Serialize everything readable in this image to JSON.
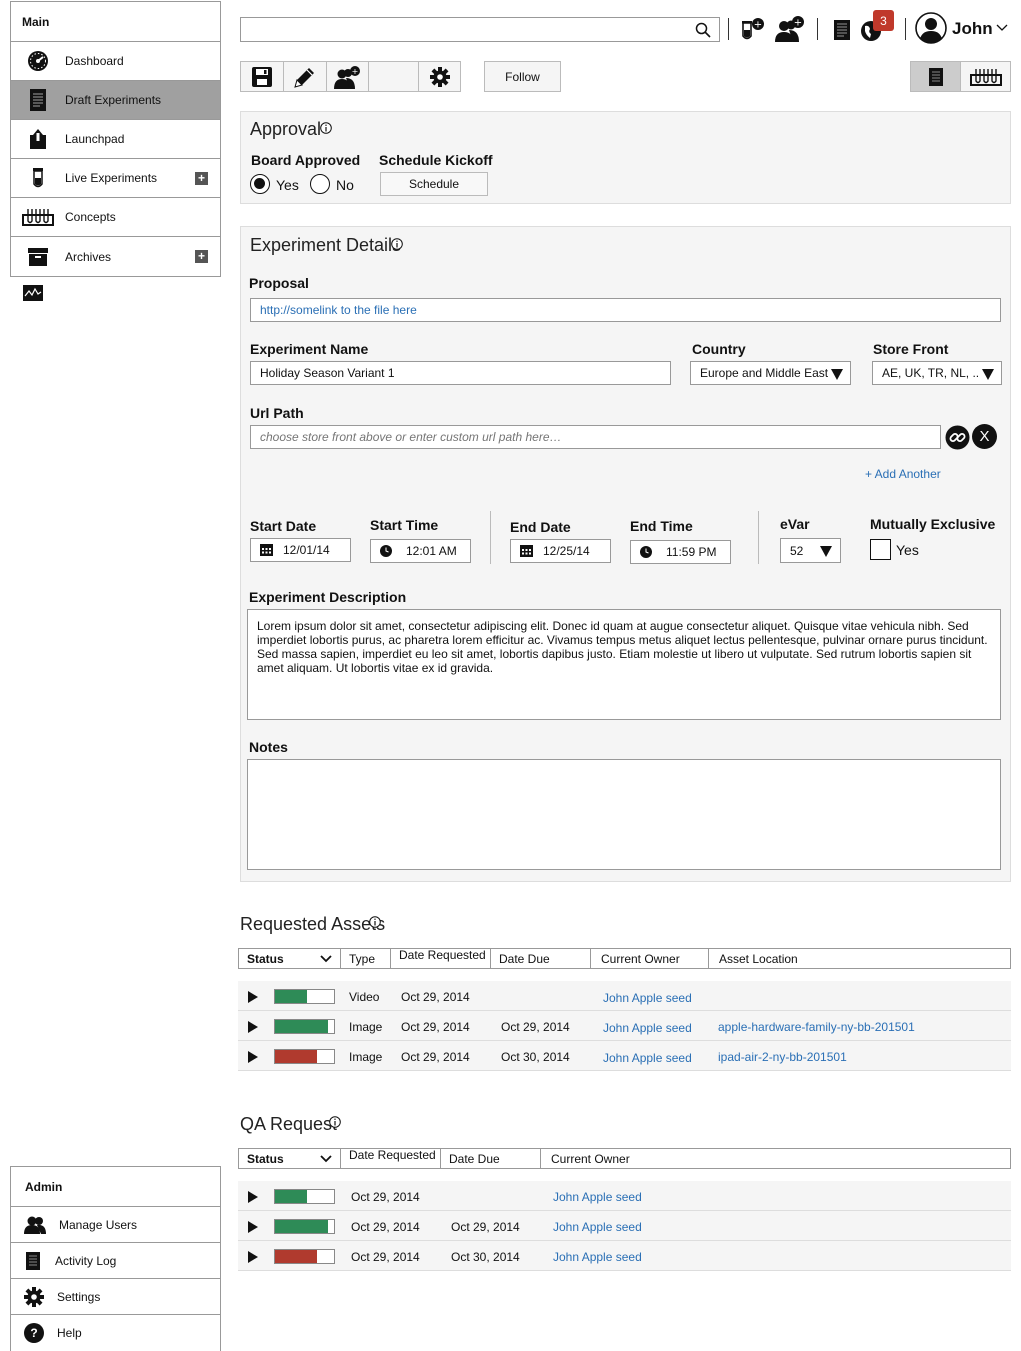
{
  "sidebar": {
    "main_header": "Main",
    "items": [
      {
        "label": "Dashboard",
        "icon": "speedometer-icon"
      },
      {
        "label": "Draft Experiments",
        "icon": "document-icon"
      },
      {
        "label": "Launchpad",
        "icon": "upload-icon"
      },
      {
        "label": "Live Experiments",
        "icon": "test-tube-icon",
        "plus": "+"
      },
      {
        "label": "Concepts",
        "icon": "test-tubes-rack-icon"
      },
      {
        "label": "Archives",
        "icon": "archive-box-icon",
        "plus": "+"
      }
    ],
    "admin_header": "Admin",
    "admin_items": [
      {
        "label": "Manage Users",
        "icon": "users-icon"
      },
      {
        "label": "Activity Log",
        "icon": "log-icon"
      },
      {
        "label": "Settings",
        "icon": "gear-icon"
      },
      {
        "label": "Help",
        "icon": "help-icon",
        "glyph": "?"
      }
    ]
  },
  "topbar": {
    "search_value": "",
    "notification_count": "3",
    "user_name": "John"
  },
  "toolbar": {
    "follow_label": "Follow"
  },
  "approval": {
    "title": "Approval",
    "board_label": "Board Approved",
    "yes": "Yes",
    "no": "No",
    "selected": "Yes",
    "schedule_label": "Schedule Kickoff",
    "schedule_button": "Schedule"
  },
  "details": {
    "title": "Experiment Details",
    "proposal_label": "Proposal",
    "proposal_value": "http://somelink to the file here",
    "name_label": "Experiment Name",
    "name_value": "Holiday Season Variant 1",
    "country_label": "Country",
    "country_value": "Europe and Middle East",
    "store_label": "Store Front",
    "store_value": "AE, UK, TR, NL, ...",
    "url_label": "Url Path",
    "url_placeholder": "choose store front above or enter custom url path here…",
    "clear_glyph": "X",
    "add_another": "+ Add Another",
    "start_date_label": "Start Date",
    "start_date": "12/01/14",
    "start_time_label": "Start Time",
    "start_time": "12:01 AM",
    "end_date_label": "End Date",
    "end_date": "12/25/14",
    "end_time_label": "End Time",
    "end_time": "11:59 PM",
    "evar_label": "eVar",
    "evar_value": "52",
    "mutex_label": "Mutually Exclusive",
    "mutex_option": "Yes",
    "desc_label": "Experiment Description",
    "desc_value": "Lorem ipsum dolor sit amet, consectetur adipiscing elit. Donec id quam at augue consectetur aliquet. Quisque vitae vehicula nibh. Sed imperdiet lobortis purus, ac pharetra lorem efficitur ac. Vivamus tempus metus aliquet lectus pellentesque, pulvinar ornare purus tincidunt. Sed massa sapien, imperdiet eu leo sit amet, lobortis dapibus justo. Etiam molestie ut libero ut vulputate. Sed rutrum lobortis sapien sit amet aliquam. Ut lobortis vitae ex id gravida.",
    "notes_label": "Notes",
    "notes_value": ""
  },
  "assets": {
    "title": "Requested Assets",
    "columns": [
      "Status",
      "Type",
      "Date Requested",
      "Date Due",
      "Current Owner",
      "Asset Location"
    ],
    "rows": [
      {
        "progress": 0.55,
        "color": "#2e8b57",
        "type": "Video",
        "requested": "Oct 29, 2014",
        "due": "",
        "owner": "John Apple seed",
        "location": ""
      },
      {
        "progress": 0.9,
        "color": "#2e8b57",
        "type": "Image",
        "requested": "Oct 29, 2014",
        "due": "Oct 29, 2014",
        "owner": "John Apple seed",
        "location": "apple-hardware-family-ny-bb-201501"
      },
      {
        "progress": 0.72,
        "color": "#b03a2e",
        "type": "Image",
        "requested": "Oct 29, 2014",
        "due": "Oct 30, 2014",
        "owner": "John Apple seed",
        "location": "ipad-air-2-ny-bb-201501"
      }
    ]
  },
  "qa": {
    "title": "QA Request",
    "columns": [
      "Status",
      "Date Requested",
      "Date Due",
      "Current Owner"
    ],
    "rows": [
      {
        "progress": 0.55,
        "color": "#2e8b57",
        "requested": "Oct 29, 2014",
        "due": "",
        "owner": "John Apple seed"
      },
      {
        "progress": 0.9,
        "color": "#2e8b57",
        "requested": "Oct 29, 2014",
        "due": "Oct 29, 2014",
        "owner": "John Apple seed"
      },
      {
        "progress": 0.72,
        "color": "#b03a2e",
        "requested": "Oct 29, 2014",
        "due": "Oct 30, 2014",
        "owner": "John Apple seed"
      }
    ]
  }
}
